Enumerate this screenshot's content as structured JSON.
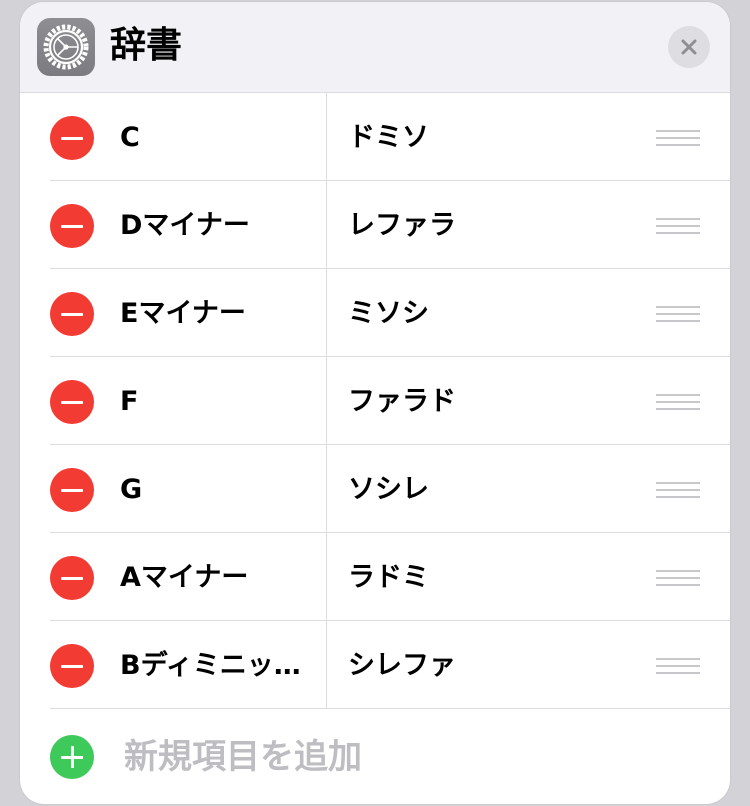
{
  "header": {
    "title": "辞書",
    "app_icon": "settings-gear-icon",
    "close_icon": "close-x-icon"
  },
  "entries": [
    {
      "word": "C",
      "reading": "ドミソ"
    },
    {
      "word": "Dマイナー",
      "reading": "レファラ"
    },
    {
      "word": "Eマイナー",
      "reading": "ミソシ"
    },
    {
      "word": "F",
      "reading": "ファラド"
    },
    {
      "word": "G",
      "reading": "ソシレ"
    },
    {
      "word": "Aマイナー",
      "reading": "ラドミ"
    },
    {
      "word": "Bディミニッ…",
      "reading": "シレファ"
    }
  ],
  "add_new": {
    "label": "新規項目を追加"
  },
  "colors": {
    "delete": "#f23c33",
    "add": "#3ec95b",
    "header_bg": "#f2f2f6",
    "placeholder_text": "#bdbdc2"
  }
}
